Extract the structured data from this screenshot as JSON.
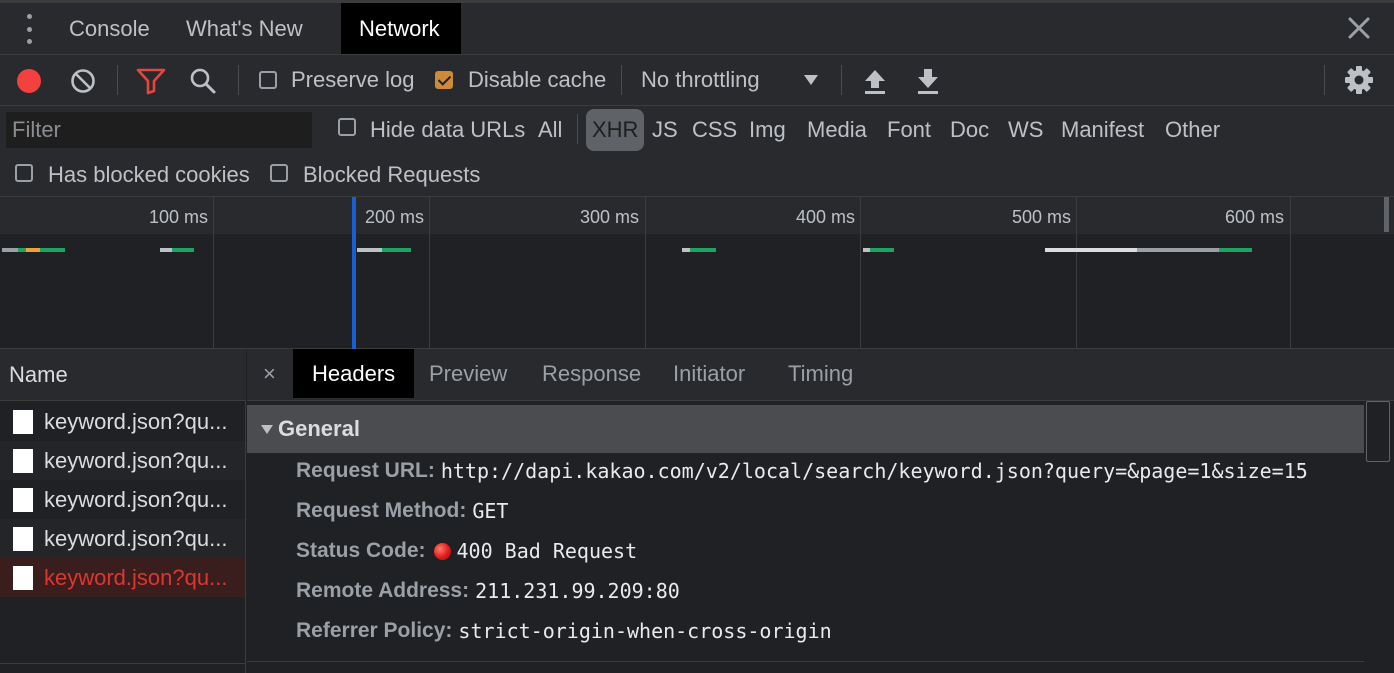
{
  "tabs": [
    {
      "label": "Console",
      "active": false
    },
    {
      "label": "What's New",
      "active": false
    },
    {
      "label": "Network",
      "active": true
    }
  ],
  "icons": {
    "menu": "kebab-menu-icon",
    "close": "close-icon",
    "record": "record-icon",
    "clear": "clear-icon",
    "filter": "filter-icon",
    "search": "search-icon",
    "upload": "import-har-icon",
    "download": "export-har-icon",
    "settings": "gear-icon",
    "file": "document-icon",
    "status_dot": "status-error-icon"
  },
  "colors": {
    "record": "#f2413f",
    "filter_active": "#e8453c",
    "checkbox_checked": "#ce8a3c",
    "timeline_marker": "#1a5fd0",
    "error_text": "#e0352f"
  },
  "toolbar": {
    "preserve_log_label": "Preserve log",
    "preserve_log_checked": false,
    "disable_cache_label": "Disable cache",
    "disable_cache_checked": true,
    "throttling_value": "No throttling"
  },
  "filter": {
    "placeholder": "Filter",
    "hide_data_urls_label": "Hide data URLs",
    "resource_types": [
      "All",
      "XHR",
      "JS",
      "CSS",
      "Img",
      "Media",
      "Font",
      "Doc",
      "WS",
      "Manifest",
      "Other"
    ],
    "active_type": "XHR",
    "has_blocked_cookies_label": "Has blocked cookies",
    "blocked_requests_label": "Blocked Requests"
  },
  "timeline": {
    "ticks": [
      "100 ms",
      "200 ms",
      "300 ms",
      "400 ms",
      "500 ms",
      "600 ms"
    ]
  },
  "requests": {
    "column_header": "Name",
    "items": [
      {
        "name": "keyword.json?qu...",
        "error": false
      },
      {
        "name": "keyword.json?qu...",
        "error": false
      },
      {
        "name": "keyword.json?qu...",
        "error": false
      },
      {
        "name": "keyword.json?qu...",
        "error": false
      },
      {
        "name": "keyword.json?qu...",
        "error": true
      }
    ]
  },
  "detail": {
    "close_label": "×",
    "tabs": [
      {
        "label": "Headers",
        "active": true
      },
      {
        "label": "Preview",
        "active": false
      },
      {
        "label": "Response",
        "active": false
      },
      {
        "label": "Initiator",
        "active": false
      },
      {
        "label": "Timing",
        "active": false
      }
    ],
    "general": {
      "title": "General",
      "rows": [
        {
          "key": "Request URL:",
          "value": "http://dapi.kakao.com/v2/local/search/keyword.json?query=&page=1&size=15"
        },
        {
          "key": "Request Method:",
          "value": "GET"
        },
        {
          "key": "Status Code:",
          "value": "400 Bad Request"
        },
        {
          "key": "Remote Address:",
          "value": "211.231.99.209:80"
        },
        {
          "key": "Referrer Policy:",
          "value": "strict-origin-when-cross-origin"
        }
      ]
    }
  }
}
